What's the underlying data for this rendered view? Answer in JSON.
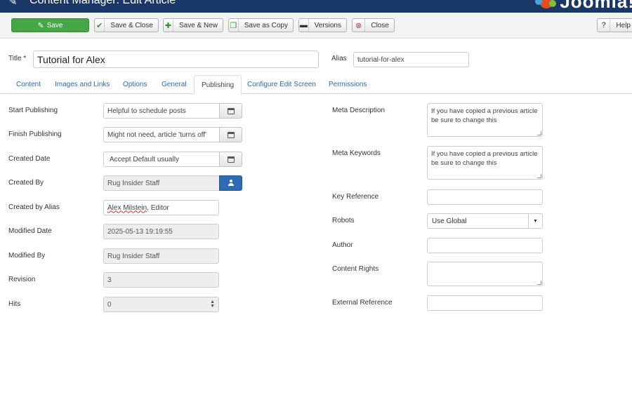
{
  "header": {
    "title": "Content Manager: Edit Article",
    "brand": "Joomla!"
  },
  "toolbar": {
    "save": "Save",
    "save_close": "Save & Close",
    "save_new": "Save & New",
    "save_copy": "Save as Copy",
    "versions": "Versions",
    "close": "Close",
    "help": "Help"
  },
  "title_row": {
    "title_label": "Title *",
    "title_value": "Tutorial for Alex",
    "alias_label": "Alias",
    "alias_value": "tutorial-for-alex"
  },
  "tabs": [
    "Content",
    "Images and Links",
    "Options",
    "General",
    "Publishing",
    "Configure Edit Screen",
    "Permissions"
  ],
  "left": {
    "start_publishing": {
      "label": "Start Publishing",
      "value": "Helpful to schedule posts"
    },
    "finish_publishing": {
      "label": "Finish Publishing",
      "value": "Might not need, article 'turns off'"
    },
    "created_date": {
      "label": "Created Date",
      "value": "Accept Default usually"
    },
    "created_by": {
      "label": "Created By",
      "value": "Rug Insider Staff"
    },
    "created_by_alias": {
      "label": "Created by Alias",
      "value_name": "Alex Milstein",
      "value_rest": ", Editor"
    },
    "modified_date": {
      "label": "Modified Date",
      "value": "2025-05-13 19:19:55"
    },
    "modified_by": {
      "label": "Modified By",
      "value": "Rug Insider Staff"
    },
    "revision": {
      "label": "Revision",
      "value": "3"
    },
    "hits": {
      "label": "Hits",
      "value": "0"
    }
  },
  "right": {
    "meta_description": {
      "label": "Meta Description",
      "value": "If you have copied a previous article be sure to change this"
    },
    "meta_keywords": {
      "label": "Meta Keywords",
      "value": "If you have copied a previous article be sure to change this"
    },
    "key_reference": {
      "label": "Key Reference",
      "value": ""
    },
    "robots": {
      "label": "Robots",
      "value": "Use Global"
    },
    "author": {
      "label": "Author",
      "value": ""
    },
    "content_rights": {
      "label": "Content Rights",
      "value": ""
    },
    "external_reference": {
      "label": "External Reference",
      "value": ""
    }
  },
  "icons": {
    "save": "edit-icon",
    "save_close": "check-icon",
    "save_new": "plus-icon",
    "save_copy": "copy-icon",
    "versions": "archive-icon",
    "close": "close-circle-icon",
    "help": "question-icon",
    "calendar": "calendar-icon",
    "user": "user-icon"
  },
  "colors": {
    "header_bg": "#1a3867",
    "save_green": "#46a546",
    "user_btn_blue": "#2d6bb4",
    "link_blue": "#2a69b8"
  }
}
